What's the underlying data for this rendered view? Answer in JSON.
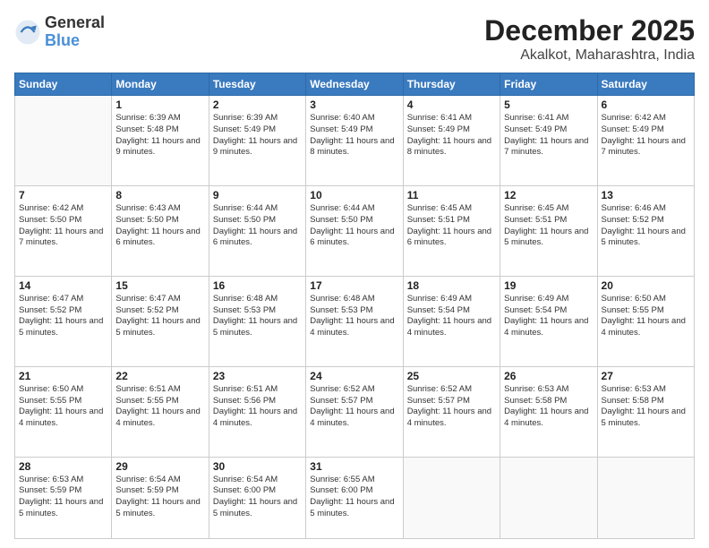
{
  "logo": {
    "general": "General",
    "blue": "Blue"
  },
  "header": {
    "month": "December 2025",
    "location": "Akalkot, Maharashtra, India"
  },
  "weekdays": [
    "Sunday",
    "Monday",
    "Tuesday",
    "Wednesday",
    "Thursday",
    "Friday",
    "Saturday"
  ],
  "weeks": [
    [
      {
        "day": "",
        "empty": true
      },
      {
        "day": "1",
        "sunrise": "6:39 AM",
        "sunset": "5:48 PM",
        "daylight": "11 hours and 9 minutes."
      },
      {
        "day": "2",
        "sunrise": "6:39 AM",
        "sunset": "5:49 PM",
        "daylight": "11 hours and 9 minutes."
      },
      {
        "day": "3",
        "sunrise": "6:40 AM",
        "sunset": "5:49 PM",
        "daylight": "11 hours and 8 minutes."
      },
      {
        "day": "4",
        "sunrise": "6:41 AM",
        "sunset": "5:49 PM",
        "daylight": "11 hours and 8 minutes."
      },
      {
        "day": "5",
        "sunrise": "6:41 AM",
        "sunset": "5:49 PM",
        "daylight": "11 hours and 7 minutes."
      },
      {
        "day": "6",
        "sunrise": "6:42 AM",
        "sunset": "5:49 PM",
        "daylight": "11 hours and 7 minutes."
      }
    ],
    [
      {
        "day": "7",
        "sunrise": "6:42 AM",
        "sunset": "5:50 PM",
        "daylight": "11 hours and 7 minutes."
      },
      {
        "day": "8",
        "sunrise": "6:43 AM",
        "sunset": "5:50 PM",
        "daylight": "11 hours and 6 minutes."
      },
      {
        "day": "9",
        "sunrise": "6:44 AM",
        "sunset": "5:50 PM",
        "daylight": "11 hours and 6 minutes."
      },
      {
        "day": "10",
        "sunrise": "6:44 AM",
        "sunset": "5:50 PM",
        "daylight": "11 hours and 6 minutes."
      },
      {
        "day": "11",
        "sunrise": "6:45 AM",
        "sunset": "5:51 PM",
        "daylight": "11 hours and 6 minutes."
      },
      {
        "day": "12",
        "sunrise": "6:45 AM",
        "sunset": "5:51 PM",
        "daylight": "11 hours and 5 minutes."
      },
      {
        "day": "13",
        "sunrise": "6:46 AM",
        "sunset": "5:52 PM",
        "daylight": "11 hours and 5 minutes."
      }
    ],
    [
      {
        "day": "14",
        "sunrise": "6:47 AM",
        "sunset": "5:52 PM",
        "daylight": "11 hours and 5 minutes."
      },
      {
        "day": "15",
        "sunrise": "6:47 AM",
        "sunset": "5:52 PM",
        "daylight": "11 hours and 5 minutes."
      },
      {
        "day": "16",
        "sunrise": "6:48 AM",
        "sunset": "5:53 PM",
        "daylight": "11 hours and 5 minutes."
      },
      {
        "day": "17",
        "sunrise": "6:48 AM",
        "sunset": "5:53 PM",
        "daylight": "11 hours and 4 minutes."
      },
      {
        "day": "18",
        "sunrise": "6:49 AM",
        "sunset": "5:54 PM",
        "daylight": "11 hours and 4 minutes."
      },
      {
        "day": "19",
        "sunrise": "6:49 AM",
        "sunset": "5:54 PM",
        "daylight": "11 hours and 4 minutes."
      },
      {
        "day": "20",
        "sunrise": "6:50 AM",
        "sunset": "5:55 PM",
        "daylight": "11 hours and 4 minutes."
      }
    ],
    [
      {
        "day": "21",
        "sunrise": "6:50 AM",
        "sunset": "5:55 PM",
        "daylight": "11 hours and 4 minutes."
      },
      {
        "day": "22",
        "sunrise": "6:51 AM",
        "sunset": "5:55 PM",
        "daylight": "11 hours and 4 minutes."
      },
      {
        "day": "23",
        "sunrise": "6:51 AM",
        "sunset": "5:56 PM",
        "daylight": "11 hours and 4 minutes."
      },
      {
        "day": "24",
        "sunrise": "6:52 AM",
        "sunset": "5:57 PM",
        "daylight": "11 hours and 4 minutes."
      },
      {
        "day": "25",
        "sunrise": "6:52 AM",
        "sunset": "5:57 PM",
        "daylight": "11 hours and 4 minutes."
      },
      {
        "day": "26",
        "sunrise": "6:53 AM",
        "sunset": "5:58 PM",
        "daylight": "11 hours and 4 minutes."
      },
      {
        "day": "27",
        "sunrise": "6:53 AM",
        "sunset": "5:58 PM",
        "daylight": "11 hours and 5 minutes."
      }
    ],
    [
      {
        "day": "28",
        "sunrise": "6:53 AM",
        "sunset": "5:59 PM",
        "daylight": "11 hours and 5 minutes."
      },
      {
        "day": "29",
        "sunrise": "6:54 AM",
        "sunset": "5:59 PM",
        "daylight": "11 hours and 5 minutes."
      },
      {
        "day": "30",
        "sunrise": "6:54 AM",
        "sunset": "6:00 PM",
        "daylight": "11 hours and 5 minutes."
      },
      {
        "day": "31",
        "sunrise": "6:55 AM",
        "sunset": "6:00 PM",
        "daylight": "11 hours and 5 minutes."
      },
      {
        "day": "",
        "empty": true
      },
      {
        "day": "",
        "empty": true
      },
      {
        "day": "",
        "empty": true
      }
    ]
  ]
}
